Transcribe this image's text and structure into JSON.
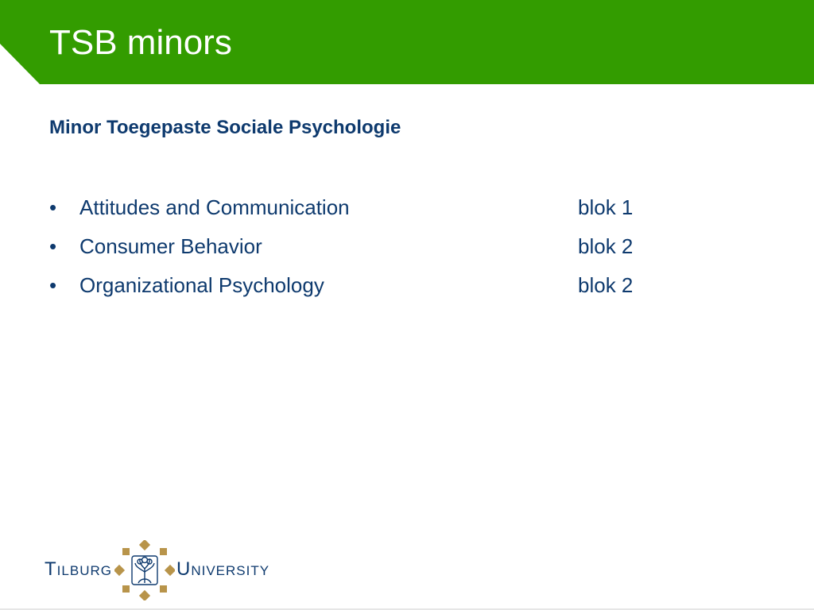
{
  "header": {
    "title": "TSB minors",
    "band_color": "#339c00"
  },
  "content": {
    "subtitle": "Minor Toegepaste Sociale Psychologie",
    "courses": [
      {
        "bullet": "•",
        "name": "Attitudes and Communication",
        "block": "blok 1"
      },
      {
        "bullet": "•",
        "name": "Consumer Behavior",
        "block": "blok 2"
      },
      {
        "bullet": "•",
        "name": "Organizational Psychology",
        "block": "blok 2"
      }
    ],
    "text_color": "#0e3a6e"
  },
  "footer": {
    "logo": {
      "word_left": "Tilburg",
      "word_right": "University",
      "seal_icon": "tilburg-seal-icon",
      "accent_color": "#b8944a"
    }
  }
}
